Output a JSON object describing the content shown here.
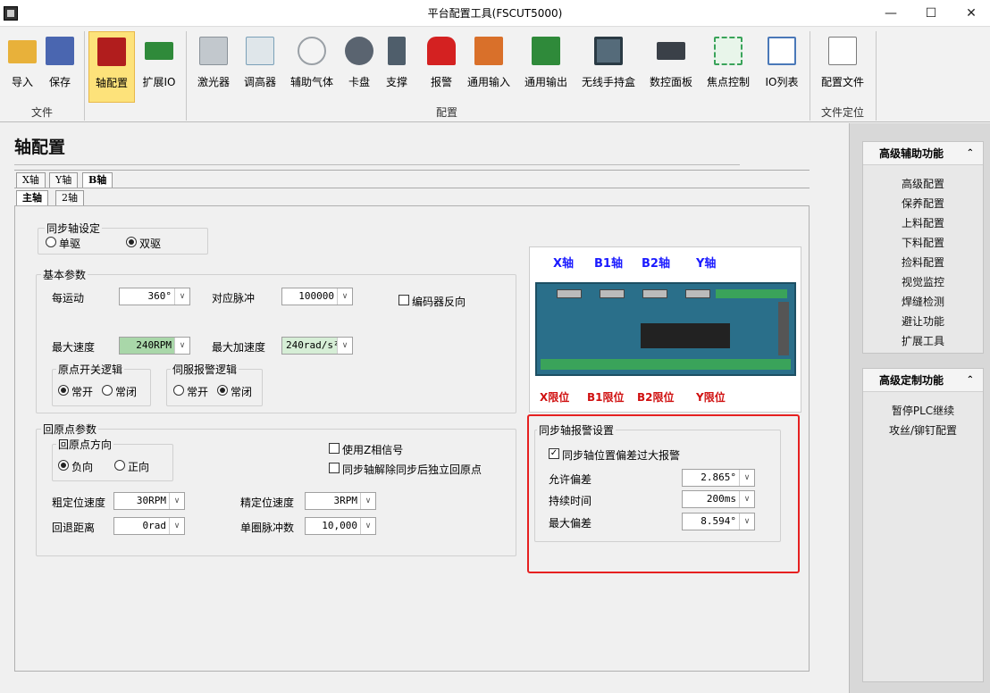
{
  "window": {
    "title": "平台配置工具(FSCUT5000)",
    "min_btn": "—",
    "max_btn": "☐",
    "close_btn": "✕"
  },
  "ribbon": {
    "buttons": [
      {
        "label": "导入",
        "icon": "folder-open-icon",
        "color": "#e8b13a"
      },
      {
        "label": "保存",
        "icon": "save-disk-icon",
        "color": "#4a66b0"
      },
      {
        "label": "轴配置",
        "icon": "axis-motor-icon",
        "color": "#b11d1d"
      },
      {
        "label": "扩展IO",
        "icon": "circuit-board-icon",
        "color": "#2f8a3a"
      },
      {
        "label": "激光器",
        "icon": "laser-icon",
        "color": "#8a9299"
      },
      {
        "label": "调高器",
        "icon": "height-controller-icon",
        "color": "#7aa0b8"
      },
      {
        "label": "辅助气体",
        "icon": "pressure-gauge-icon",
        "color": "#9aa0a6"
      },
      {
        "label": "卡盘",
        "icon": "chuck-icon",
        "color": "#5a6470"
      },
      {
        "label": "支撑",
        "icon": "support-icon",
        "color": "#4f5e6b"
      },
      {
        "label": "报警",
        "icon": "alarm-light-icon",
        "color": "#d42121"
      },
      {
        "label": "通用输入",
        "icon": "input-terminal-icon",
        "color": "#d9702a"
      },
      {
        "label": "通用输出",
        "icon": "output-terminal-icon",
        "color": "#2f8a3a"
      },
      {
        "label": "无线手持盒",
        "icon": "handheld-box-icon",
        "color": "#556b7a"
      },
      {
        "label": "数控面板",
        "icon": "cnc-panel-icon",
        "color": "#3a4048"
      },
      {
        "label": "焦点控制",
        "icon": "focus-control-icon",
        "color": "#3aa35a"
      },
      {
        "label": "IO列表",
        "icon": "io-list-icon",
        "color": "#4a78b8"
      },
      {
        "label": "配置文件",
        "icon": "config-file-icon",
        "color": "#7a7a7a"
      }
    ],
    "groups": {
      "file": "文件",
      "config": "配置",
      "file_locate": "文件定位"
    }
  },
  "page": {
    "title": "轴配置"
  },
  "tabs": {
    "axis": [
      "X轴",
      "Y轴",
      "B轴"
    ],
    "sub": [
      "主轴",
      "2轴"
    ]
  },
  "sync": {
    "title": "同步轴设定",
    "single": "单驱",
    "dual": "双驱"
  },
  "basic": {
    "title": "基本参数",
    "per_motion_label": "每运动",
    "per_motion_value": "360°",
    "pulse_label": "对应脉冲",
    "pulse_value": "100000",
    "encoder_reverse": "编码器反向",
    "max_speed_label": "最大速度",
    "max_speed_value": "240RPM",
    "max_accel_label": "最大加速度",
    "max_accel_value": "240rad/s²",
    "origin_logic_title": "原点开关逻辑",
    "servo_logic_title": "伺服报警逻辑",
    "normally_open": "常开",
    "normally_closed": "常闭"
  },
  "origin": {
    "title": "回原点参数",
    "dir_title": "回原点方向",
    "negative": "负向",
    "positive": "正向",
    "use_z": "使用Z相信号",
    "sync_release": "同步轴解除同步后独立回原点",
    "coarse_speed_label": "粗定位速度",
    "coarse_speed_value": "30RPM",
    "fine_speed_label": "精定位速度",
    "fine_speed_value": "3RPM",
    "back_dist_label": "回退距离",
    "back_dist_value": "0rad",
    "pulses_label": "单圈脉冲数",
    "pulses_value": "10,000"
  },
  "board": {
    "top_labels": [
      "X轴",
      "B1轴",
      "B2轴",
      "Y轴"
    ],
    "bottom_labels": [
      "X限位",
      "B1限位",
      "B2限位",
      "Y限位"
    ]
  },
  "alarm": {
    "title": "同步轴报警设置",
    "enable_label": "同步轴位置偏差过大报警",
    "allow_label": "允许偏差",
    "allow_value": "2.865°",
    "duration_label": "持续时间",
    "duration_value": "200ms",
    "max_label": "最大偏差",
    "max_value": "8.594°"
  },
  "right_panel": {
    "aux_title": "高级辅助功能",
    "aux_items": [
      "高级配置",
      "保养配置",
      "上料配置",
      "下料配置",
      "捡料配置",
      "视觉监控",
      "焊缝检测",
      "避让功能",
      "扩展工具"
    ],
    "custom_title": "高级定制功能",
    "custom_items": [
      "暂停PLC继续",
      "攻丝/铆钉配置"
    ]
  },
  "colors": {
    "highlight": "#e62020",
    "active_button": "#fde27a",
    "max_speed_field": "#a9d7a9"
  }
}
